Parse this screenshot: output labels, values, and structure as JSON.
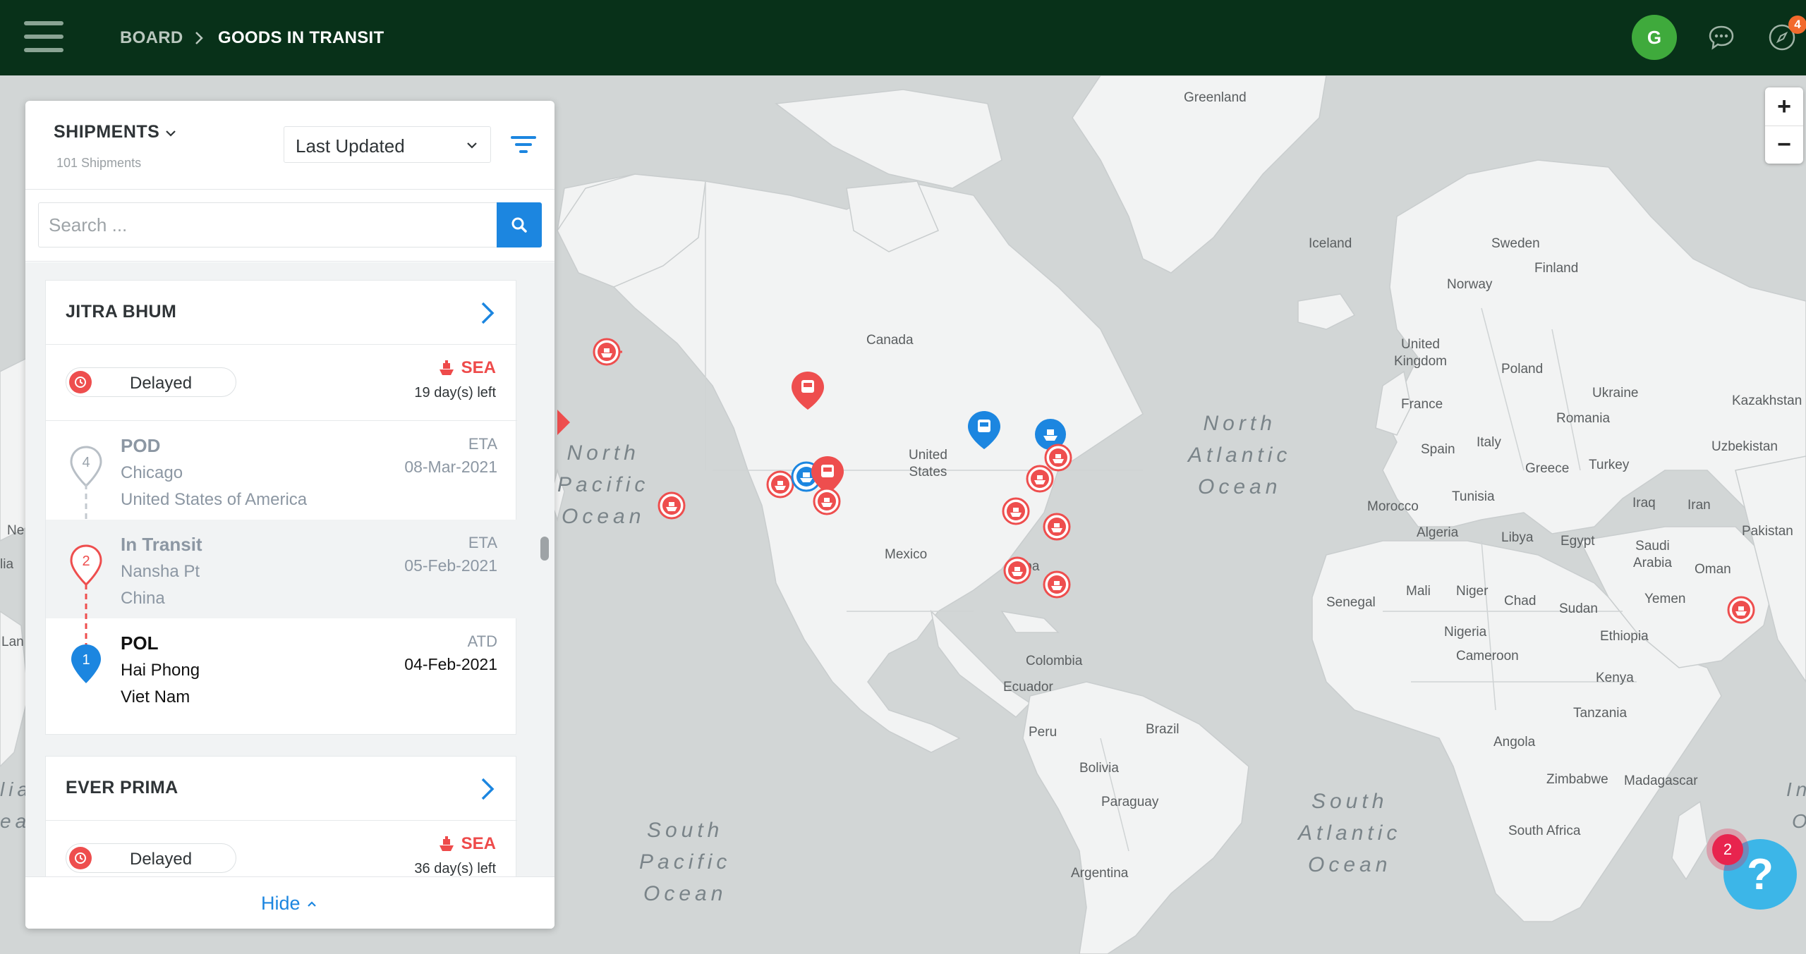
{
  "header": {
    "breadcrumb_root": "BOARD",
    "breadcrumb_current": "GOODS IN TRANSIT",
    "avatar_initial": "G",
    "notification_count": "4",
    "bg_color": "#083119"
  },
  "panel": {
    "title": "SHIPMENTS",
    "count_label": "101 Shipments",
    "sort_selected": "Last Updated",
    "search_placeholder": "Search ...",
    "hide_label": "Hide",
    "shipments": [
      {
        "name": "JITRA BHUM",
        "status": "Delayed",
        "mode": "SEA",
        "days_left": "19 day(s) left",
        "stops": [
          {
            "index": "4",
            "type": "POD",
            "city": "Chicago",
            "country": "United States of America",
            "date_label": "ETA",
            "date": "08-Mar-2021"
          },
          {
            "index": "2",
            "type": "In Transit",
            "city": "Nansha Pt",
            "country": "China",
            "date_label": "ETA",
            "date": "05-Feb-2021"
          },
          {
            "index": "1",
            "type": "POL",
            "city": "Hai Phong",
            "country": "Viet Nam",
            "date_label": "ATD",
            "date": "04-Feb-2021"
          }
        ]
      },
      {
        "name": "EVER PRIMA",
        "status": "Delayed",
        "mode": "SEA",
        "days_left": "36 day(s) left"
      }
    ]
  },
  "map": {
    "countries": {
      "greenland": "Greenland",
      "iceland": "Iceland",
      "sweden": "Sweden",
      "finland": "Finland",
      "norway": "Norway",
      "uk": "United\nKingdom",
      "poland": "Poland",
      "ukraine": "Ukraine",
      "kazakhstan": "Kazakhstan",
      "france": "France",
      "romania": "Romania",
      "spain": "Spain",
      "italy": "Italy",
      "uzbekistan": "Uzbekistan",
      "greece": "Greece",
      "turkey": "Turkey",
      "canada": "Canada",
      "usa": "United\nStates",
      "morocco": "Morocco",
      "tunisia": "Tunisia",
      "iraq": "Iraq",
      "iran": "Iran",
      "pakistan": "Pakistan",
      "algeria": "Algeria",
      "libya": "Libya",
      "egypt": "Egypt",
      "saudi": "Saudi\nArabia",
      "oman": "Oman",
      "mexico": "Mexico",
      "cuba": "Cuba",
      "senegal": "Senegal",
      "mali": "Mali",
      "niger": "Niger",
      "chad": "Chad",
      "sudan": "Sudan",
      "yemen": "Yemen",
      "nigeria": "Nigeria",
      "ethiopia": "Ethiopia",
      "colombia": "Colombia",
      "cameroon": "Cameroon",
      "ecuador": "Ecuador",
      "kenya": "Kenya",
      "peru": "Peru",
      "brazil": "Brazil",
      "tanzania": "Tanzania",
      "angola": "Angola",
      "bolivia": "Bolivia",
      "zimbabwe": "Zimbabwe",
      "madagascar": "Madagascar",
      "paraguay": "Paraguay",
      "south_africa": "South Africa",
      "argentina": "Argentina"
    },
    "oceans": {
      "north_pacific": "North\nPacific\nOcean",
      "north_atlantic": "North\nAtlantic\nOcean",
      "south_pacific": "South\nPacific\nOcean",
      "south_atlantic": "South\nAtlantic\nOcean"
    },
    "edge_fragments": [
      "Ne",
      "lia",
      "Lan",
      "lia",
      "ea",
      "In",
      "O"
    ],
    "zoom_in": "+",
    "zoom_out": "−",
    "help_badge": "2",
    "help_symbol": "?",
    "colors": {
      "sea_marker": "#ee4e4e",
      "rail_marker": "#1c86e0",
      "land": "#f2f3f3",
      "water": "#d2d6d6"
    }
  }
}
